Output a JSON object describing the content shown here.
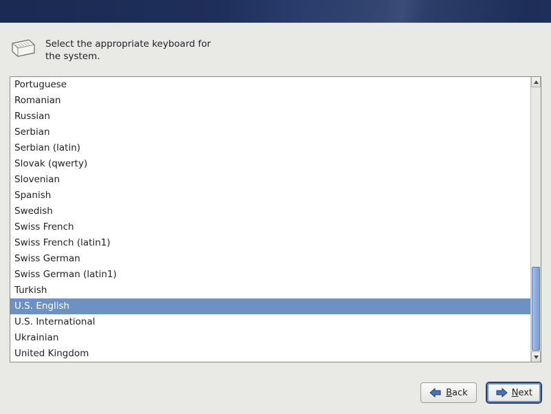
{
  "instruction": "Select the appropriate keyboard for the system.",
  "keyboards": [
    "Portuguese",
    "Romanian",
    "Russian",
    "Serbian",
    "Serbian (latin)",
    "Slovak (qwerty)",
    "Slovenian",
    "Spanish",
    "Swedish",
    "Swiss French",
    "Swiss French (latin1)",
    "Swiss German",
    "Swiss German (latin1)",
    "Turkish",
    "U.S. English",
    "U.S. International",
    "Ukrainian",
    "United Kingdom"
  ],
  "selected_index": 14,
  "buttons": {
    "back": {
      "underline": "B",
      "rest": "ack"
    },
    "next": {
      "underline": "N",
      "rest": "ext"
    }
  }
}
